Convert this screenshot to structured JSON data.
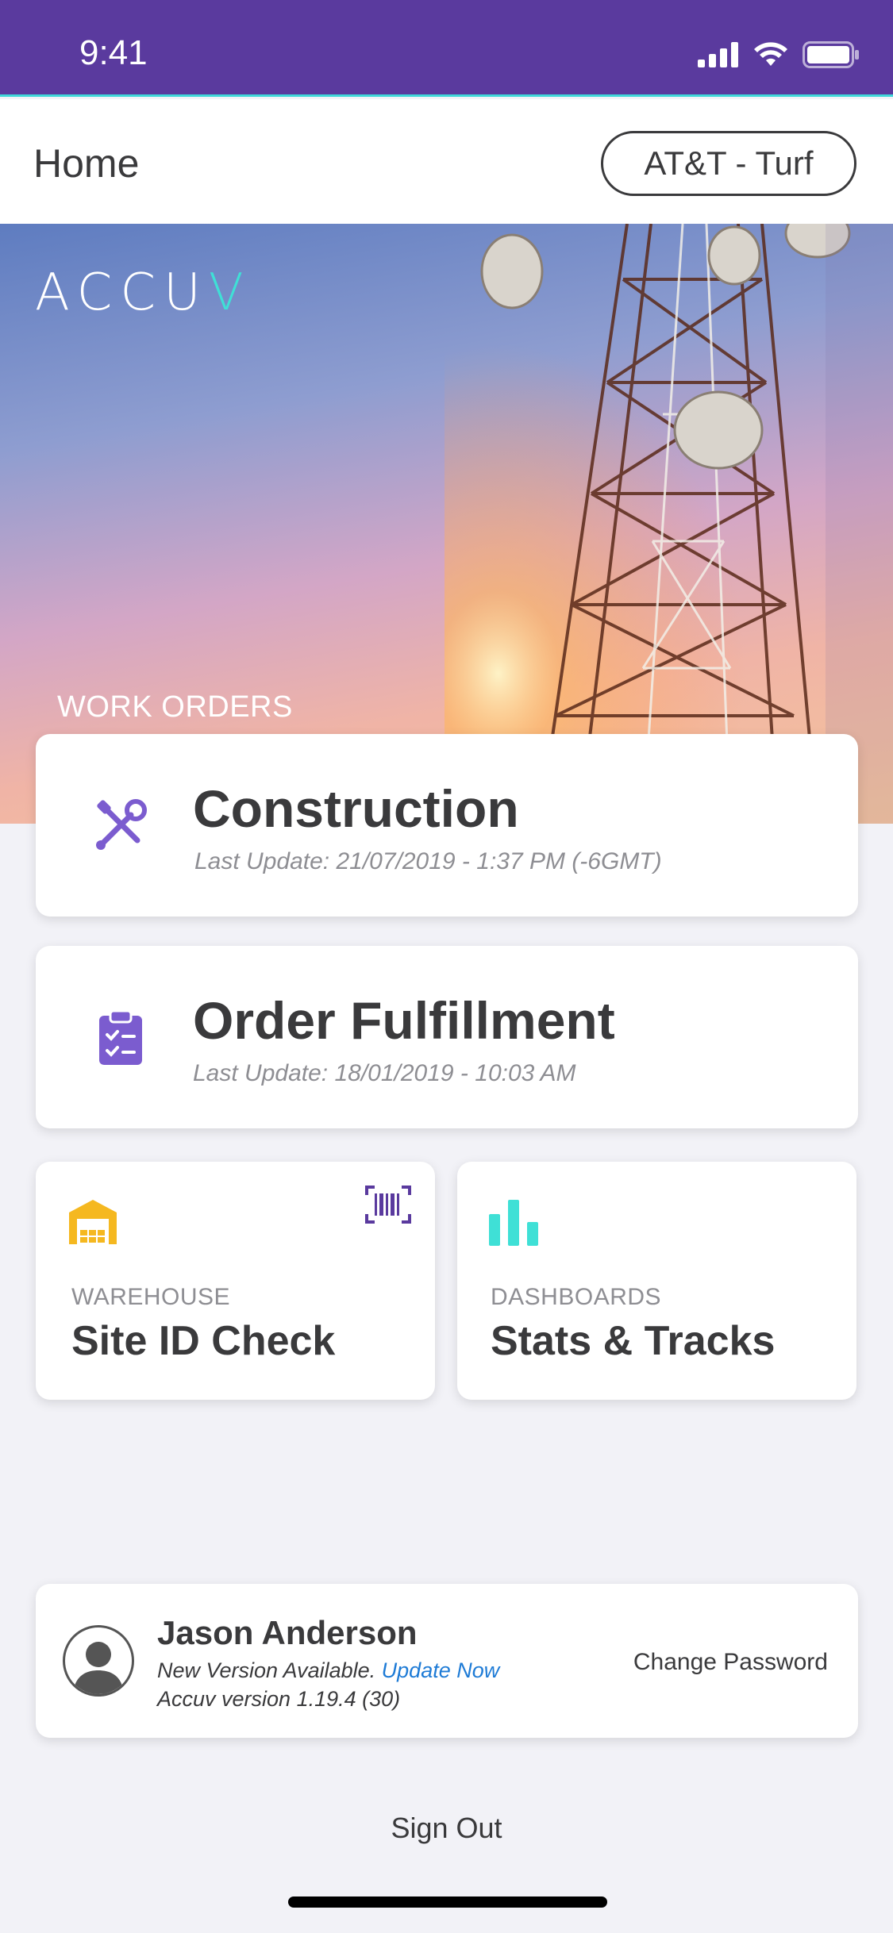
{
  "status_bar": {
    "time": "9:41"
  },
  "header": {
    "title": "Home",
    "account": "AT&T - Turf"
  },
  "hero": {
    "logo_main": "ACCU",
    "logo_accent": "V",
    "section_label": "WORK ORDERS"
  },
  "work_orders": [
    {
      "title": "Construction",
      "last_update": "Last Update: 21/07/2019 - 1:37 PM (-6GMT)",
      "icon": "tools-icon"
    },
    {
      "title": "Order Fulfillment",
      "last_update": "Last Update: 18/01/2019 - 10:03 AM",
      "icon": "clipboard-check-icon"
    }
  ],
  "tiles": [
    {
      "category": "WAREHOUSE",
      "title": "Site ID Check",
      "icon": "warehouse-icon",
      "action_icon": "barcode-scan-icon"
    },
    {
      "category": "DASHBOARDS",
      "title": "Stats & Tracks",
      "icon": "bar-chart-icon"
    }
  ],
  "profile": {
    "name": "Jason Anderson",
    "update_notice": "New Version Available.",
    "update_link": "Update Now",
    "version": "Accuv version 1.19.4 (30)",
    "change_password": "Change Password"
  },
  "sign_out": "Sign Out",
  "colors": {
    "brand_purple": "#5a3a9e",
    "accent_teal": "#3fe0d6",
    "icon_purple": "#7b5ccf",
    "warehouse_yellow": "#f5b820",
    "link_blue": "#1e7bd6"
  }
}
